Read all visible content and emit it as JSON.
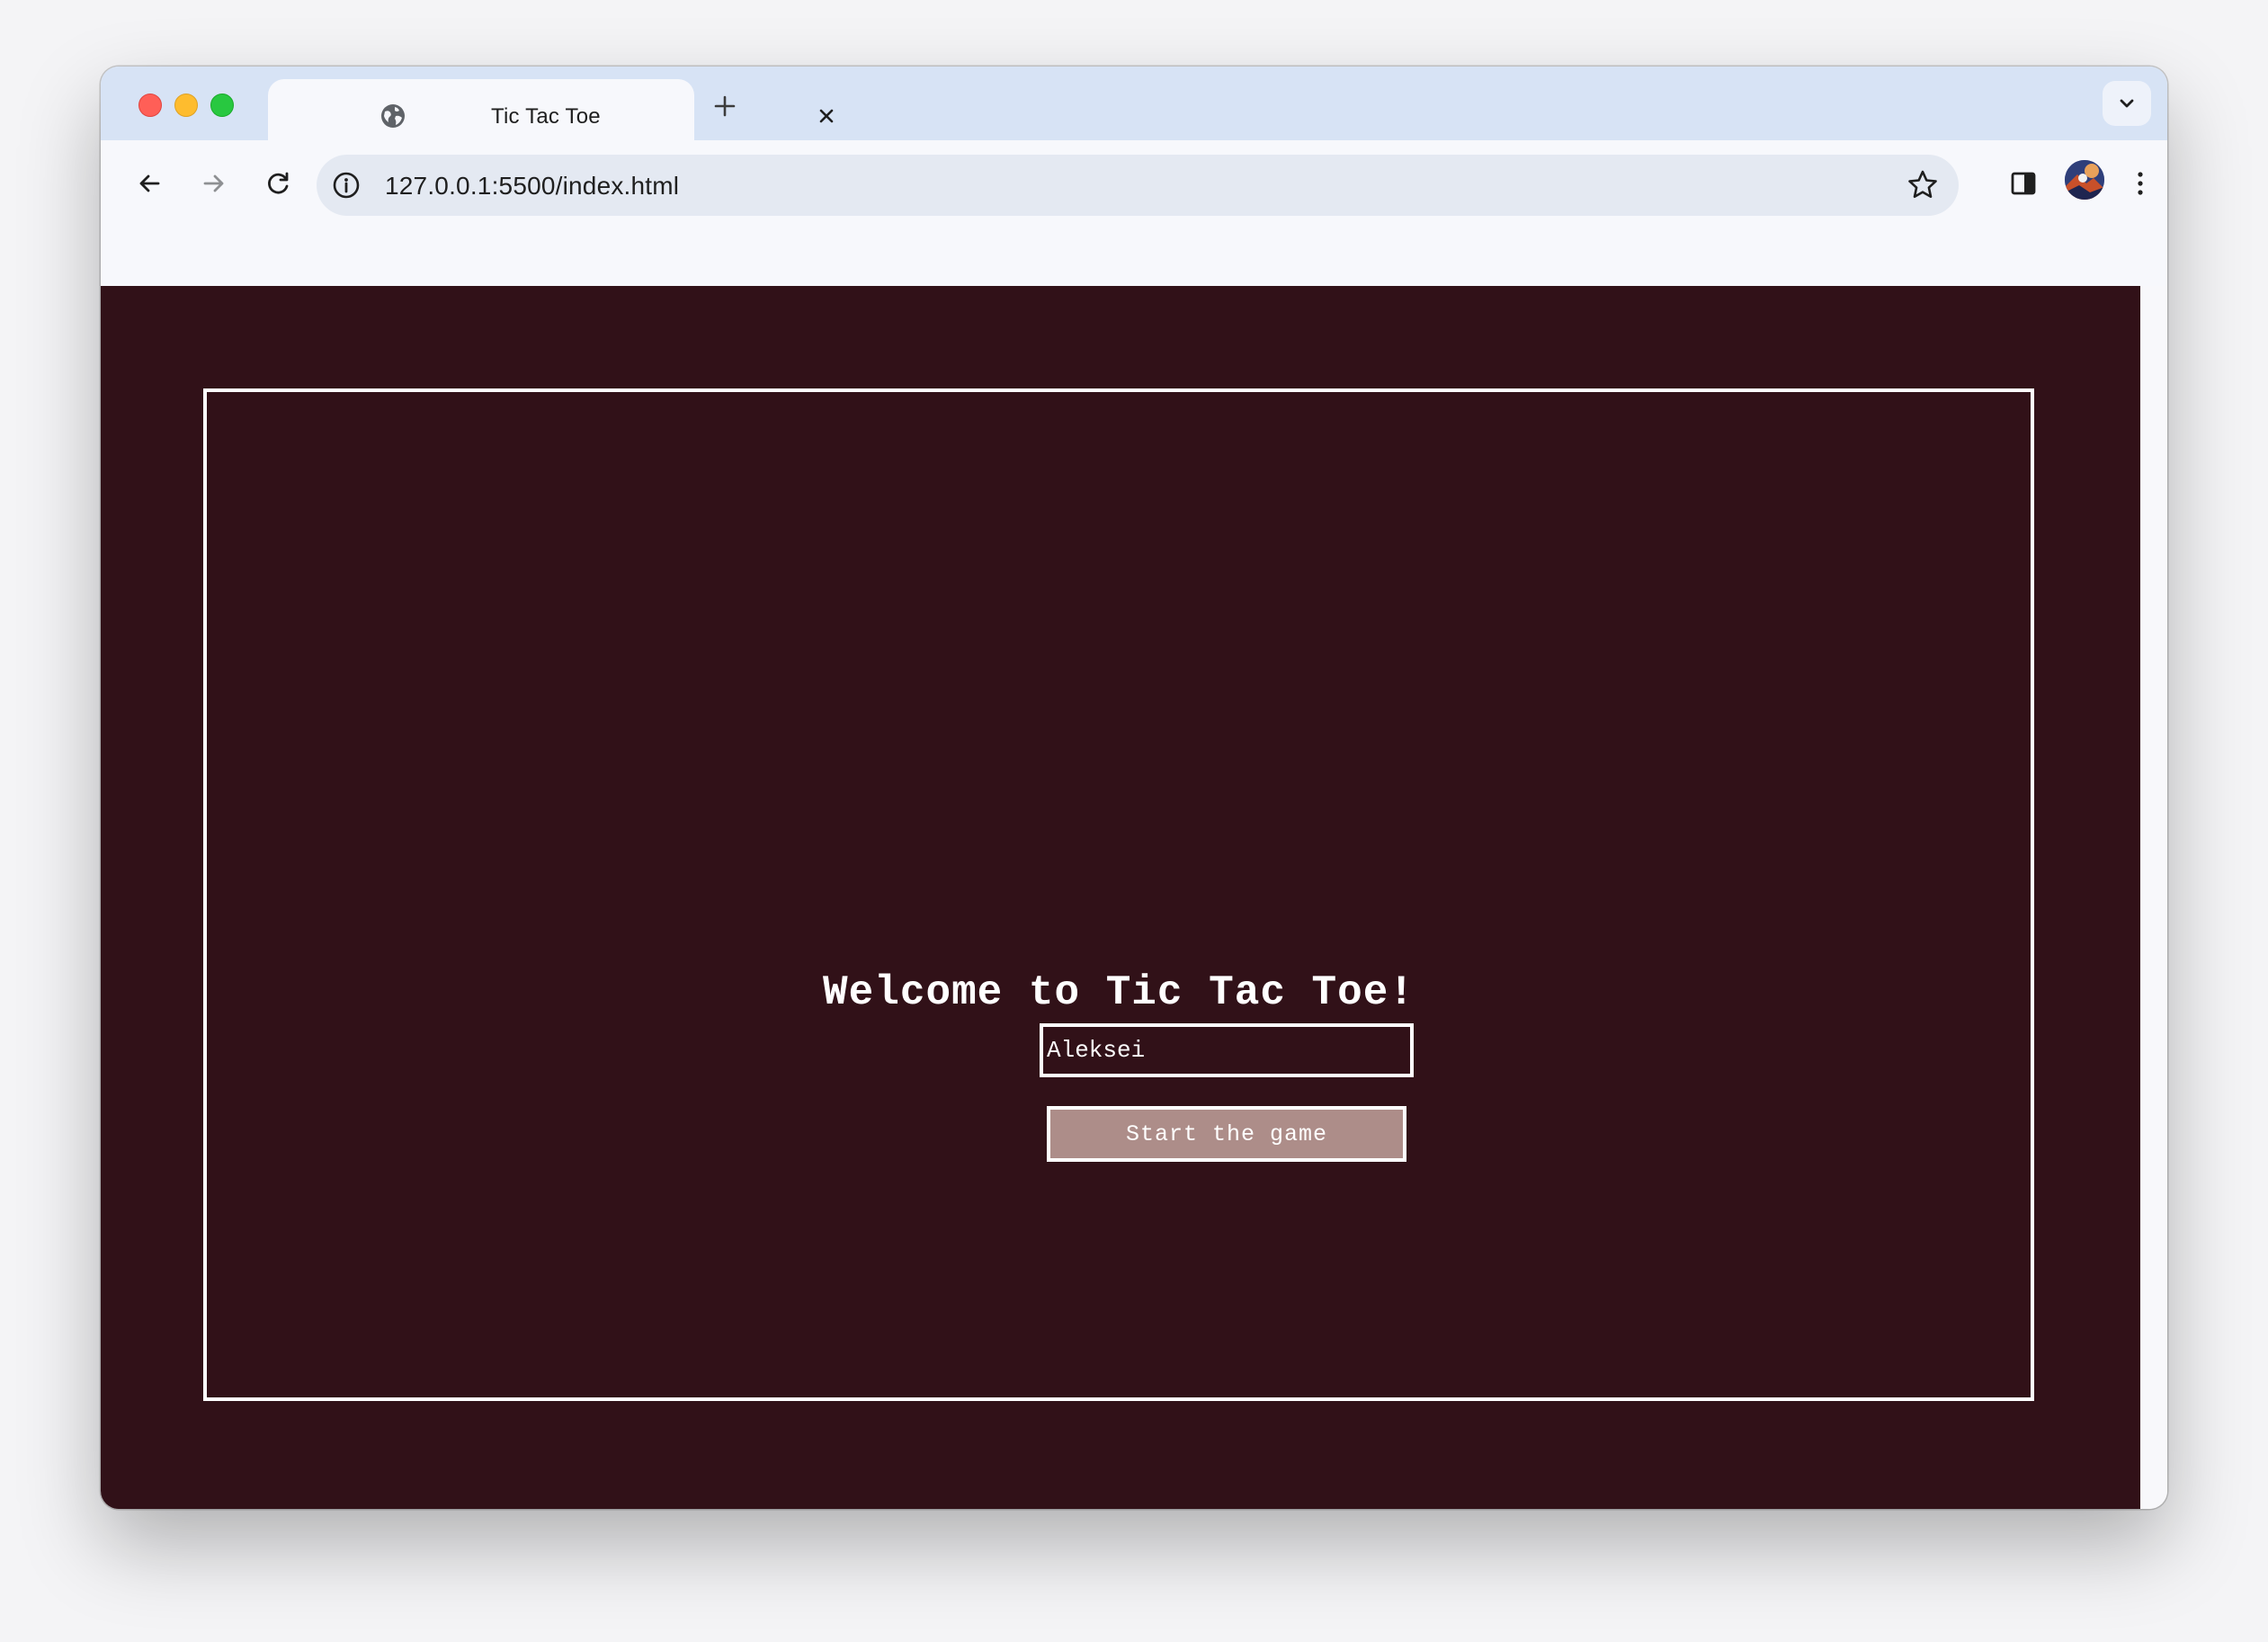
{
  "browser": {
    "tab": {
      "title": "Tic Tac Toe",
      "icon": "globe-icon"
    },
    "address_bar": {
      "url": "127.0.0.1:5500/index.html"
    },
    "icons": {
      "back": "back-arrow-icon",
      "forward": "forward-arrow-icon",
      "reload": "reload-icon",
      "info": "info-icon",
      "bookmark": "star-icon",
      "side_panel": "side-panel-icon",
      "menu": "kebab-menu-icon",
      "new_tab": "plus-icon",
      "close_tab": "close-icon",
      "tab_list": "chevron-down-icon"
    }
  },
  "page": {
    "heading": "Welcome to Tic Tac Toe!",
    "name_input": {
      "value": "Aleksei"
    },
    "start_button_label": "Start the game"
  },
  "colors": {
    "page_background": "#311118",
    "frame_border": "#ffffff",
    "button_background": "#ad8d89",
    "text": "#ffffff"
  }
}
